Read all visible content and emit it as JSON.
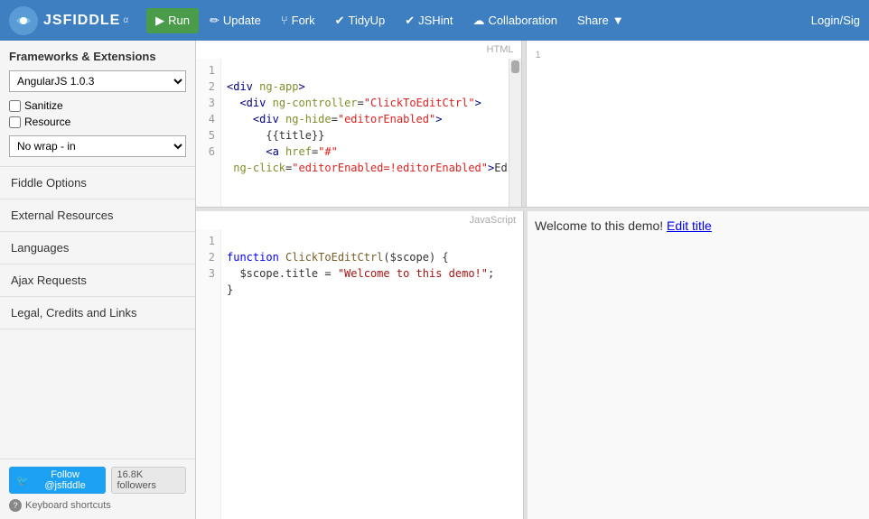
{
  "brand": {
    "name": "JSFIDDLE",
    "alpha": "α",
    "logo_text": "☁"
  },
  "navbar": {
    "run": "Run",
    "update": "Update",
    "fork": "Fork",
    "tidyup": "TidyUp",
    "jshint": "JSHint",
    "collaboration": "Collaboration",
    "share": "Share",
    "login": "Login/Sig"
  },
  "sidebar": {
    "title": "Frameworks & Extensions",
    "framework_options": [
      "AngularJS 1.0.3"
    ],
    "framework_selected": "AngularJS 1.0.3",
    "sanitize_label": "Sanitize",
    "resource_label": "Resource",
    "nowrap_options": [
      "No wrap - in <head>"
    ],
    "nowrap_selected": "No wrap - in <head>",
    "nav_items": [
      "Fiddle Options",
      "External Resources",
      "Languages",
      "Ajax Requests",
      "Legal, Credits and Links"
    ],
    "twitter_btn": "Follow @jsfiddle",
    "followers": "16.8K followers",
    "keyboard_label": "Keyboard shortcuts"
  },
  "html_editor": {
    "label": "HTML",
    "lines": [
      "1",
      "2",
      "3",
      "4",
      "5",
      "6"
    ],
    "code": "<div ng-app>\n  <div ng-controller=\"ClickToEditCtrl\">\n    <div ng-hide=\"editorEnabled\">\n      {{title}}\n      <a href=\"#\"\n ng-click=\"editorEnabled=!editorEnabled\">Edit title</a>"
  },
  "js_editor": {
    "label": "JavaScript",
    "lines": [
      "1",
      "2",
      "3"
    ],
    "code": "function ClickToEditCtrl($scope) {\n  $scope.title = \"Welcome to this demo!\";\n}"
  },
  "result": {
    "text": "Welcome to this demo!",
    "link_text": "Edit title"
  }
}
